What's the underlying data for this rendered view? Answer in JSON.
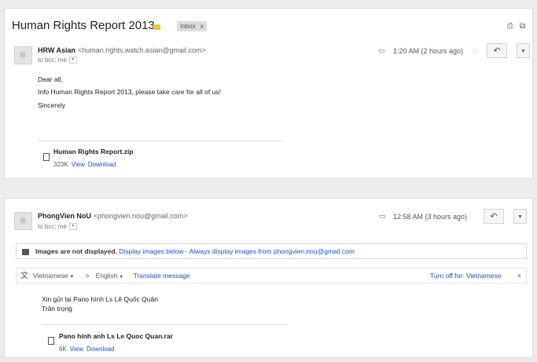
{
  "thread": {
    "subject": "Human Rights Report 2013",
    "label": "Inbox",
    "label_close": "x"
  },
  "icons": {
    "print": "print-icon",
    "new_window": "new-window-icon",
    "reply": "reply-icon",
    "more": "chevron-down-icon",
    "star": "star-icon",
    "label": "label-icon",
    "attachment": "attachment-icon",
    "image": "image-icon",
    "translate": "translate-icon"
  },
  "messages": [
    {
      "sender_name": "HRW Asian",
      "sender_email": "<human.rights.watch.asian@gmail.com>",
      "to": "to bcc: me",
      "time": "1:20 AM (2 hours ago)",
      "body": [
        "Dear all,",
        "Info Human Rights Report 2013, please take care for all of us!",
        "Sincerely"
      ],
      "attachment": {
        "name": "Human Rights Report.zip",
        "size": "323K",
        "view": "View",
        "download": "Download"
      }
    },
    {
      "sender_name": "PhongVien NoU",
      "sender_email": "<phongvien.nou@gmail.com>",
      "to": "to bcc: me",
      "time": "12:58 AM (3 hours ago)",
      "images_notice": {
        "bold": "Images are not displayed.",
        "link1": "Display images below",
        "sep": " - ",
        "link2": "Always display images from phongvien.nou@gmail.com"
      },
      "translate": {
        "from": "Vietnamese",
        "arrow": ">",
        "to": "English",
        "action": "Translate message",
        "turn_off": "Turn off for: Vietnamese",
        "close": "×"
      },
      "body": [
        "Xin gửi lại Pano hình Ls Lê Quốc Quân",
        "Trân trọng"
      ],
      "attachment": {
        "name": "Pano hinh anh Ls Le Quoc Quan.rar",
        "size": "6K",
        "view": "View",
        "download": "Download"
      }
    }
  ]
}
